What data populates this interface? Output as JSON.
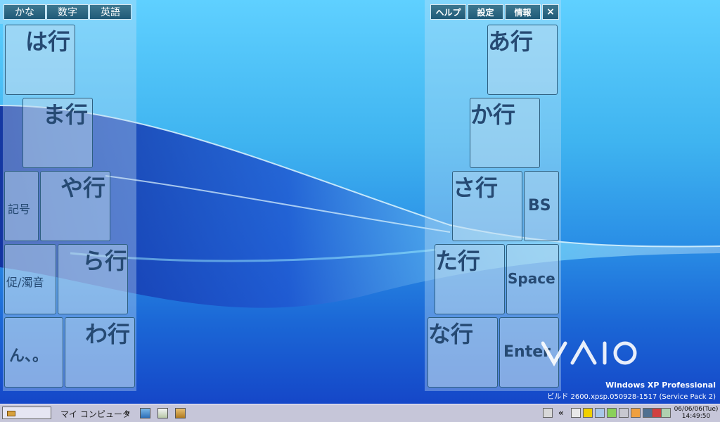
{
  "modes": [
    "かな",
    "数字",
    "英語"
  ],
  "util": {
    "help": "ヘルプ",
    "settings": "設定",
    "info": "情報",
    "close": "×"
  },
  "keys": {
    "ha": "は行",
    "ma": "ま行",
    "kigou": "記号",
    "ya": "や行",
    "dakuon": "促/濁音",
    "ra": "ら行",
    "n": "ん、。",
    "wa": "わ行",
    "a": "あ行",
    "ka": "か行",
    "sa": "さ行",
    "bs": "BS",
    "ta": "た行",
    "space": "Space",
    "na": "な行",
    "enter": "Enter"
  },
  "desktop": {
    "os": "Windows XP Professional",
    "build": "ビルド 2600.xpsp.050928-1517 (Service Pack 2)"
  },
  "taskbar": {
    "my_computer": "マイ コンピュータ",
    "chevron_left": "»",
    "chevron_tray": "«",
    "date": "06/06/06(Tue)",
    "time": "14:49:50"
  },
  "colors": {
    "key_text": "#264a73",
    "desktop": "#2a8fe6"
  }
}
